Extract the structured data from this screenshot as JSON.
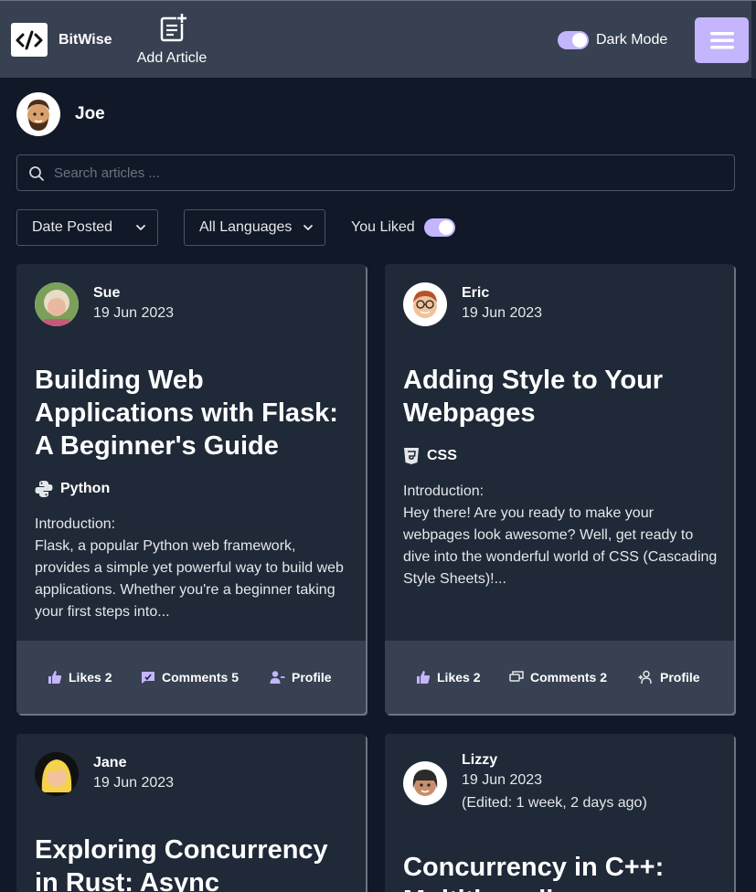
{
  "header": {
    "brand": "BitWise",
    "add_article": "Add Article",
    "dark_mode_label": "Dark Mode",
    "dark_mode_on": true,
    "accent": "#c4b5fd"
  },
  "user": {
    "name": "Joe"
  },
  "search": {
    "placeholder": "Search articles ...",
    "value": ""
  },
  "filters": {
    "sort": "Date Posted",
    "language": "All Languages",
    "liked_label": "You Liked",
    "liked_on": true
  },
  "articles": [
    {
      "author": "Sue",
      "date": "19 Jun 2023",
      "title": "Building Web Applications with Flask: A Beginner's Guide",
      "language": "Python",
      "language_icon": "python-icon",
      "intro": "Introduction:",
      "excerpt": "Flask, a popular Python web framework, provides a simple yet powerful way to build web applications. Whether you're a beginner taking your first steps into...",
      "likes": "Likes 2",
      "comments": "Comments 5",
      "profile": "Profile"
    },
    {
      "author": "Eric",
      "date": "19 Jun 2023",
      "title": "Adding Style to Your Webpages",
      "language": "CSS",
      "language_icon": "css3-icon",
      "intro": "Introduction:",
      "excerpt": "Hey there! Are you ready to make your webpages look awesome? Well, get ready to dive into the wonderful world of CSS (Cascading Style Sheets)!...",
      "likes": "Likes 2",
      "comments": "Comments 2",
      "profile": "Profile"
    },
    {
      "author": "Jane",
      "date": "19 Jun 2023",
      "title": "Exploring Concurrency in Rust: Async"
    },
    {
      "author": "Lizzy",
      "date": "19 Jun 2023",
      "edited": "(Edited: 1 week, 2 days ago)",
      "title": "Concurrency in C++: Multithreading"
    }
  ]
}
